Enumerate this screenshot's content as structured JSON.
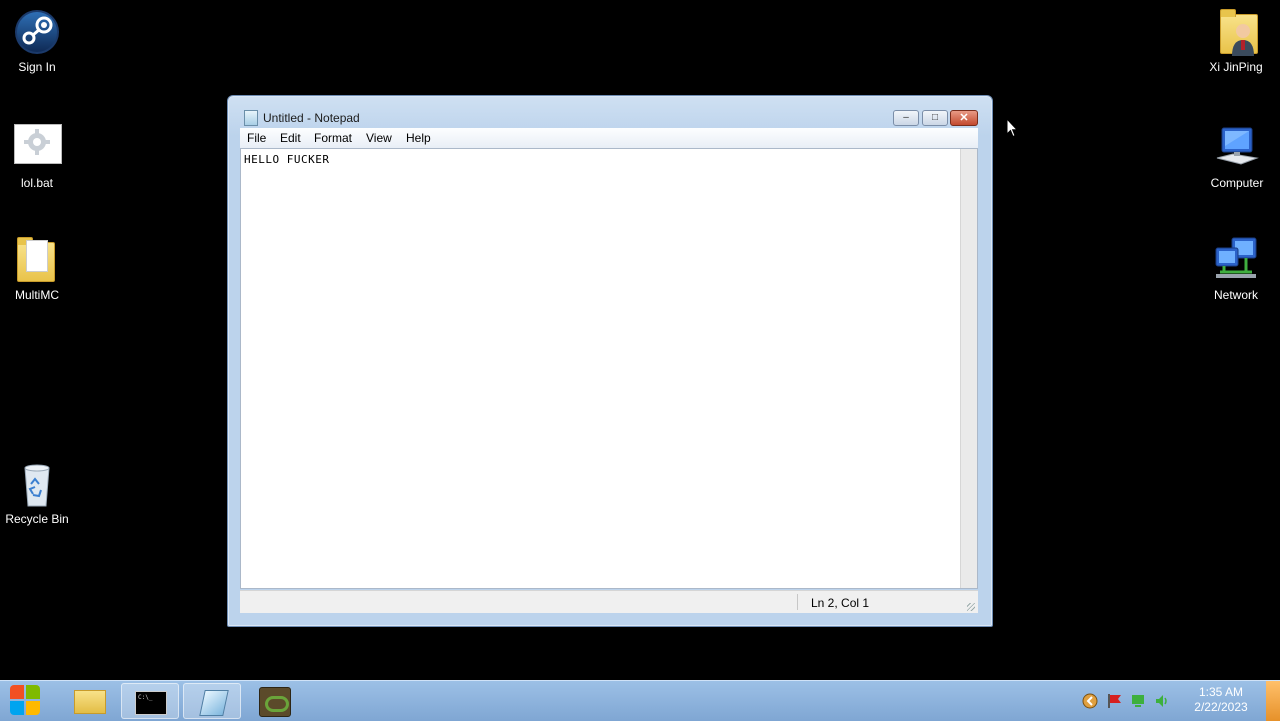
{
  "desktop": {
    "icons_left": [
      {
        "label": "Sign In",
        "icon": "steam-icon"
      },
      {
        "label": "lol.bat",
        "icon": "batch-file-icon"
      },
      {
        "label": "MultiMC",
        "icon": "folder-icon"
      },
      {
        "label": "Recycle Bin",
        "icon": "recycle-bin-icon"
      }
    ],
    "icons_right": [
      {
        "label": "Xi JinPing",
        "icon": "user-folder-icon"
      },
      {
        "label": "Computer",
        "icon": "computer-icon"
      },
      {
        "label": "Network",
        "icon": "network-icon"
      }
    ]
  },
  "notepad": {
    "title": "Untitled - Notepad",
    "menu": [
      "File",
      "Edit",
      "Format",
      "View",
      "Help"
    ],
    "content": "HELLO FUCKER",
    "status": "Ln 2, Col 1",
    "controls": {
      "minimize": "minimize-icon",
      "maximize": "maximize-icon",
      "close": "close-icon"
    }
  },
  "taskbar": {
    "start_icon": "windows-logo-icon",
    "pinned": [
      {
        "name": "explorer",
        "icon": "folder-icon"
      },
      {
        "name": "cmd",
        "icon": "command-prompt-icon",
        "glyph": "C:\\_"
      },
      {
        "name": "notepad",
        "icon": "notepad-icon",
        "active": true
      },
      {
        "name": "minecraft",
        "icon": "minecraft-icon"
      }
    ],
    "tray_icons": [
      "show-hidden-icons-icon",
      "action-center-flag-icon",
      "network-status-icon",
      "volume-icon"
    ],
    "clock": {
      "time": "1:35 AM",
      "date": "2/22/2023"
    }
  },
  "colors": {
    "desktop_bg": "#000000",
    "taskbar": "#8fb4de",
    "close_button": "#c94a2e"
  }
}
